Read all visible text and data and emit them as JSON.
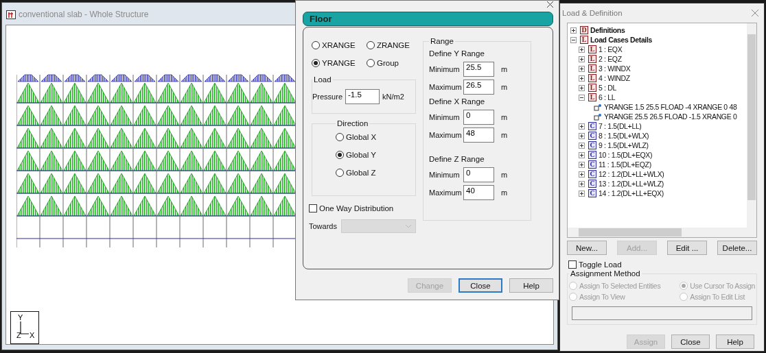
{
  "structure_window": {
    "title": "conventional slab - Whole Structure",
    "axes": [
      "Y",
      "Z",
      "X"
    ]
  },
  "dialog": {
    "header": "Floor",
    "range_type": [
      {
        "label": "XRANGE",
        "selected": false
      },
      {
        "label": "ZRANGE",
        "selected": false
      },
      {
        "label": "YRANGE",
        "selected": true
      },
      {
        "label": "Group",
        "selected": false
      }
    ],
    "load": {
      "legend": "Load",
      "label": "Pressure",
      "value": "-1.5",
      "unit": "kN/m2"
    },
    "direction": {
      "legend": "Direction",
      "options": [
        {
          "label": "Global X",
          "selected": false
        },
        {
          "label": "Global Y",
          "selected": true
        },
        {
          "label": "Global Z",
          "selected": false
        }
      ]
    },
    "one_way": {
      "label": "One Way Distribution",
      "checked": false
    },
    "towards": {
      "label": "Towards",
      "disabled": true
    },
    "range": {
      "legend": "Range",
      "groups": [
        {
          "title": "Define Y Range",
          "rows": [
            {
              "label": "Minimum",
              "value": "25.5",
              "unit": "m"
            },
            {
              "label": "Maximum",
              "value": "26.5",
              "unit": "m"
            }
          ]
        },
        {
          "title": "Define X Range",
          "rows": [
            {
              "label": "Minimum",
              "value": "0",
              "unit": "m"
            },
            {
              "label": "Maximum",
              "value": "48",
              "unit": "m"
            }
          ]
        },
        {
          "title": "Define Z Range",
          "rows": [
            {
              "label": "Minimum",
              "value": "0",
              "unit": "m"
            },
            {
              "label": "Maximum",
              "value": "40",
              "unit": "m"
            }
          ]
        }
      ]
    },
    "buttons": [
      {
        "label": "Change",
        "disabled": true
      },
      {
        "label": "Close",
        "disabled": false
      },
      {
        "label": "Help",
        "disabled": false
      }
    ]
  },
  "panel": {
    "title": "Load & Definition",
    "tree": [
      {
        "kind": "folder",
        "icon": "D",
        "label": "Definitions",
        "expanded": false
      },
      {
        "kind": "folder",
        "icon": "L",
        "label": "Load Cases Details",
        "expanded": true,
        "children": [
          {
            "kind": "load_case",
            "icon": "L",
            "label": "1 : EQX",
            "expanded": false
          },
          {
            "kind": "load_case",
            "icon": "L",
            "label": "2 : EQZ",
            "expanded": false
          },
          {
            "kind": "load_case",
            "icon": "L",
            "label": "3 : WINDX",
            "expanded": false
          },
          {
            "kind": "load_case",
            "icon": "L",
            "label": "4 : WINDZ",
            "expanded": false
          },
          {
            "kind": "load_case",
            "icon": "L",
            "label": "5 : DL",
            "expanded": false
          },
          {
            "kind": "load_case",
            "icon": "L",
            "label": "6 : LL",
            "expanded": true,
            "children": [
              {
                "kind": "load",
                "label": "YRANGE 1.5 25.5 FLOAD -4 XRANGE 0 48"
              },
              {
                "kind": "load",
                "label": "YRANGE 25.5 26.5 FLOAD -1.5 XRANGE 0"
              }
            ]
          },
          {
            "kind": "combination",
            "icon": "C",
            "label": "7 : 1.5(DL+LL)",
            "expanded": false
          },
          {
            "kind": "combination",
            "icon": "C",
            "label": "8 : 1.5(DL+WLX)",
            "expanded": false
          },
          {
            "kind": "combination",
            "icon": "C",
            "label": "9 : 1.5(DL+WLZ)",
            "expanded": false
          },
          {
            "kind": "combination",
            "icon": "C",
            "label": "10 : 1.5(DL+EQX)",
            "expanded": false
          },
          {
            "kind": "combination",
            "icon": "C",
            "label": "11 : 1.5(DL+EQZ)",
            "expanded": false
          },
          {
            "kind": "combination",
            "icon": "C",
            "label": "12 : 1.2(DL+LL+WLX)",
            "expanded": false
          },
          {
            "kind": "combination",
            "icon": "C",
            "label": "13 : 1.2(DL+LL+WLZ)",
            "expanded": false
          },
          {
            "kind": "combination",
            "icon": "C",
            "label": "14 : 1.2(DL+LL+EQX)",
            "expanded": false
          }
        ]
      }
    ],
    "buttons": [
      {
        "label": "New...",
        "disabled": false
      },
      {
        "label": "Add...",
        "disabled": true
      },
      {
        "label": "Edit ...",
        "disabled": false
      },
      {
        "label": "Delete...",
        "disabled": false
      }
    ],
    "toggle_load": {
      "label": "Toggle Load",
      "checked": false
    },
    "assignment": {
      "legend": "Assignment Method",
      "options": [
        {
          "label": "Assign To Selected Entities",
          "selected": false,
          "disabled": true
        },
        {
          "label": "Use Cursor To Assign",
          "selected": true,
          "disabled": true
        },
        {
          "label": "Assign To View",
          "selected": false,
          "disabled": true
        },
        {
          "label": "Assign To Edit List",
          "selected": false,
          "disabled": true
        }
      ]
    },
    "bottom_buttons": [
      {
        "label": "Assign",
        "disabled": true
      },
      {
        "label": "Close",
        "disabled": false
      },
      {
        "label": "Help",
        "disabled": false
      }
    ]
  }
}
